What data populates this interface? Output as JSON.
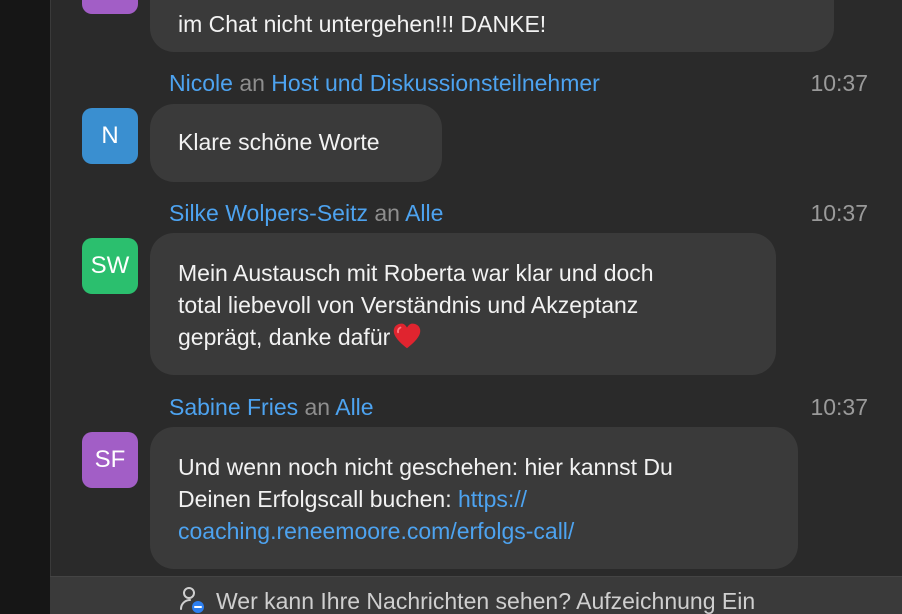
{
  "colors": {
    "panel_bg": "#2a2a2a",
    "bubble_bg": "#3a3a3a",
    "link": "#4da3f0",
    "muted": "#9a9a9a",
    "avatar_blue": "#3a8fd0",
    "avatar_green": "#2bbf6e",
    "avatar_purple": "#a25ec6"
  },
  "messages": [
    {
      "text": "im Chat nicht untergehen!!! DANKE!"
    },
    {
      "sender": "Nicole",
      "connector": "an",
      "recipient": "Host und Diskussionsteilnehmer",
      "time": "10:37",
      "avatar_initials": "N",
      "text": "Klare schöne Worte"
    },
    {
      "sender": "Silke Wolpers-Seitz",
      "connector": "an",
      "recipient": "Alle",
      "time": "10:37",
      "avatar_initials": "SW",
      "text_lines": [
        "Mein Austausch mit Roberta war klar und doch",
        "total liebevoll von Verständnis und Akzeptanz",
        "geprägt, danke dafür"
      ],
      "emoji": "red-heart"
    },
    {
      "sender": "Sabine Fries",
      "connector": "an",
      "recipient": "Alle",
      "time": "10:37",
      "avatar_initials": "SF",
      "text_lines": [
        "Und wenn noch nicht geschehen: hier kannst Du",
        "Deinen Erfolgscall buchen: "
      ],
      "link_part1": "https://",
      "link_part2": "coaching.reneemoore.com/erfolgs-call/"
    }
  ],
  "footer": {
    "text": "Wer kann Ihre Nachrichten sehen? Aufzeichnung Ein",
    "icon": "person-privacy-icon"
  }
}
